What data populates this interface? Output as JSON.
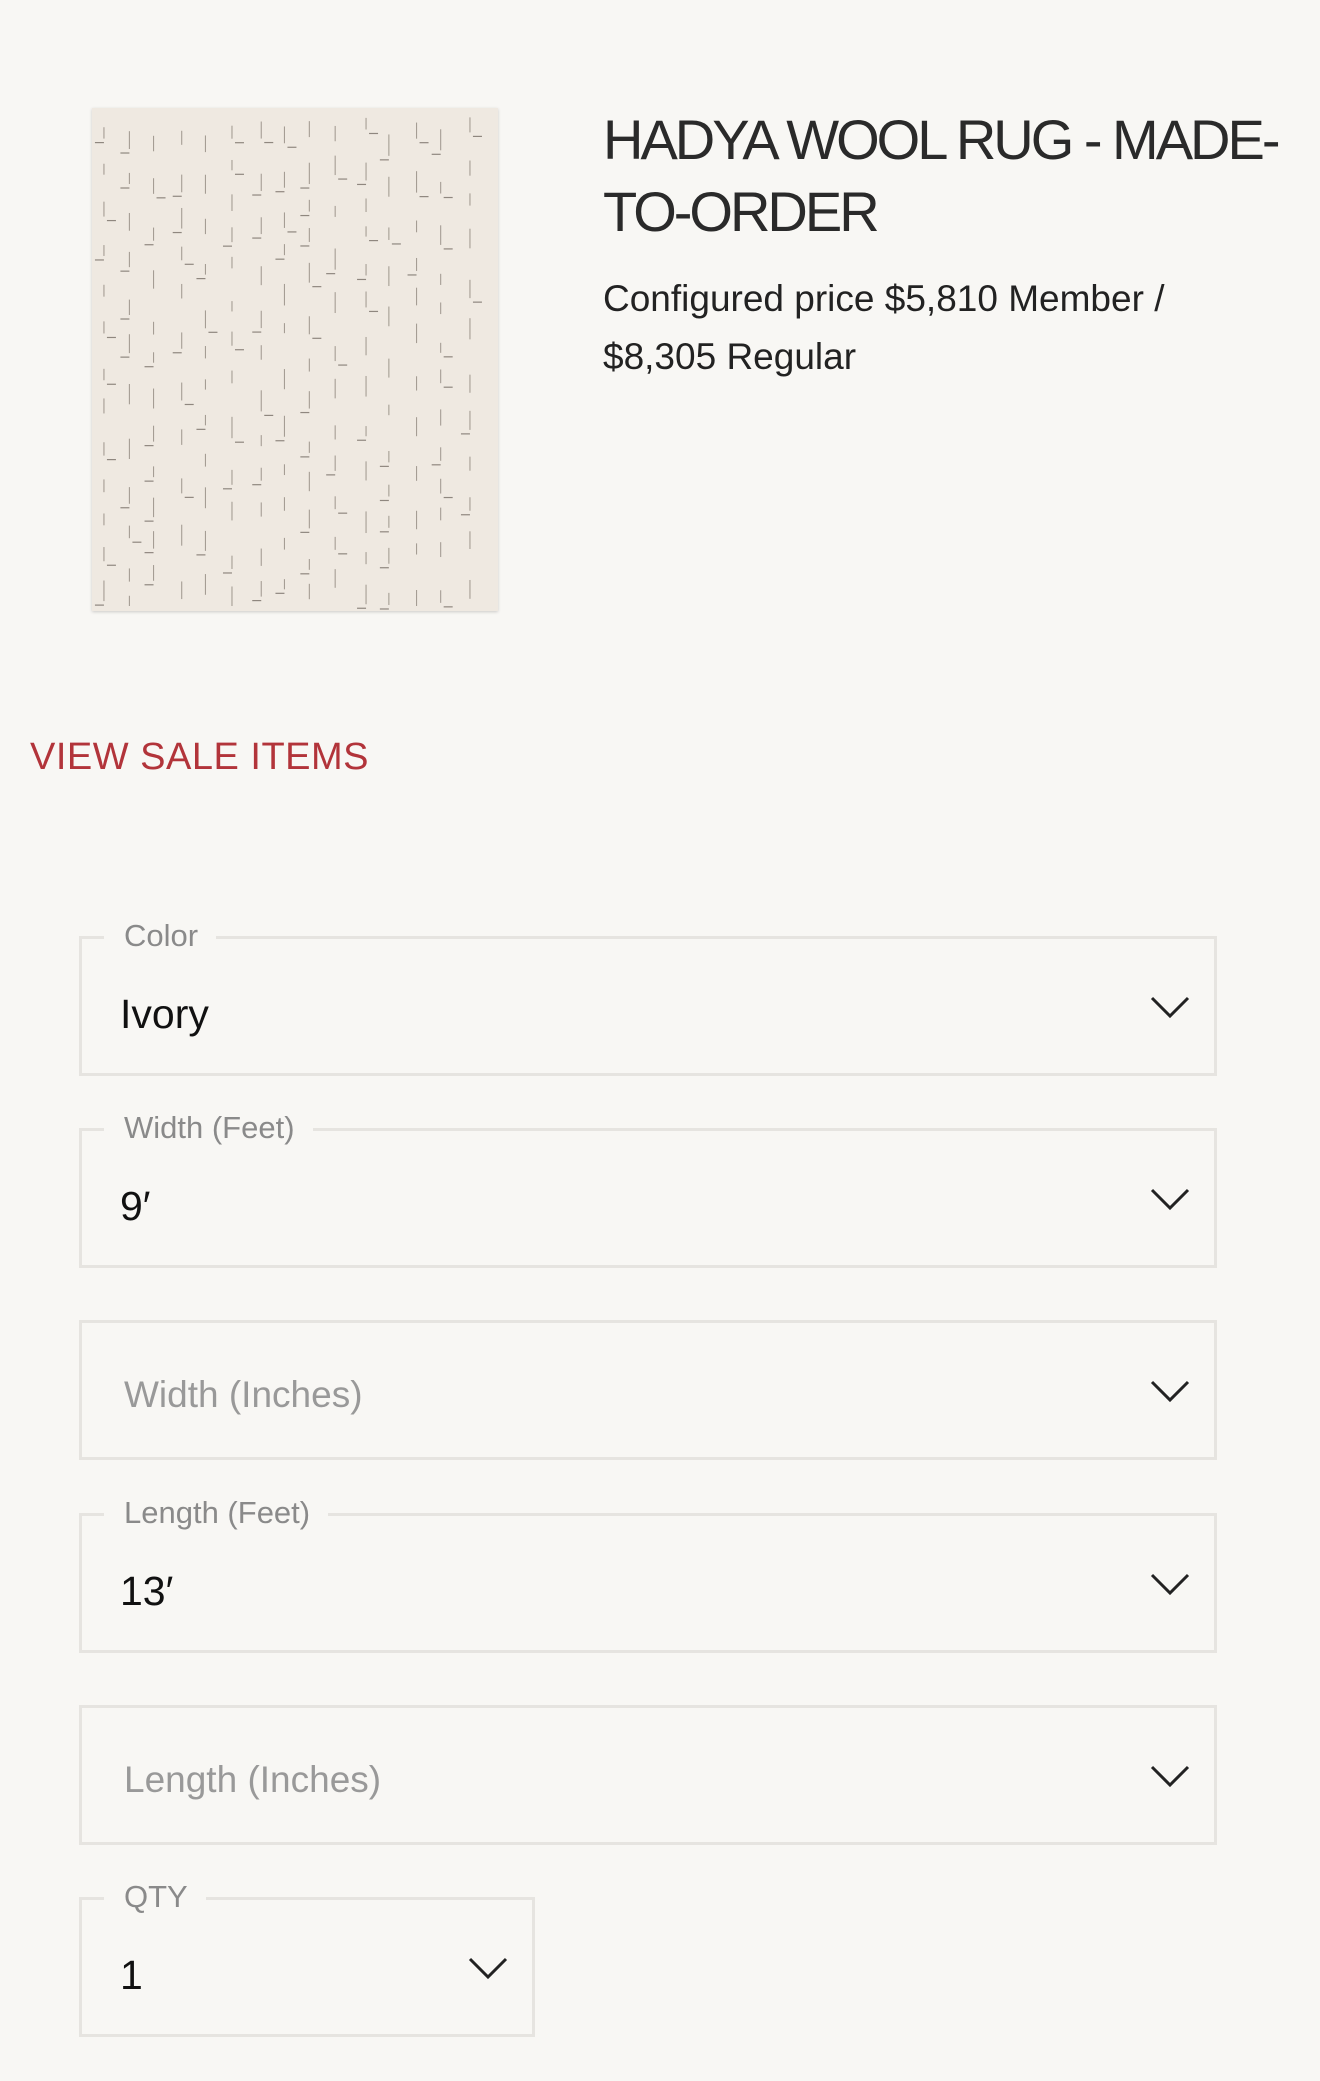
{
  "product": {
    "title": "HADYA WOOL RUG - MADE-TO-ORDER",
    "price_text": "Configured price $5,810 Member / $8,305 Regular",
    "image_icon": "rug-image"
  },
  "sale_link": {
    "label": "VIEW SALE ITEMS",
    "color": "#b2343a"
  },
  "options": {
    "color": {
      "label": "Color",
      "value": "Ivory"
    },
    "width_feet": {
      "label": "Width (Feet)",
      "value": "9′"
    },
    "width_inches": {
      "placeholder": "Width (Inches)"
    },
    "length_feet": {
      "label": "Length (Feet)",
      "value": "13′"
    },
    "length_inches": {
      "placeholder": "Length (Inches)"
    },
    "qty": {
      "label": "QTY",
      "value": "1"
    }
  },
  "icons": {
    "dropdown": "chevron-down-icon"
  }
}
